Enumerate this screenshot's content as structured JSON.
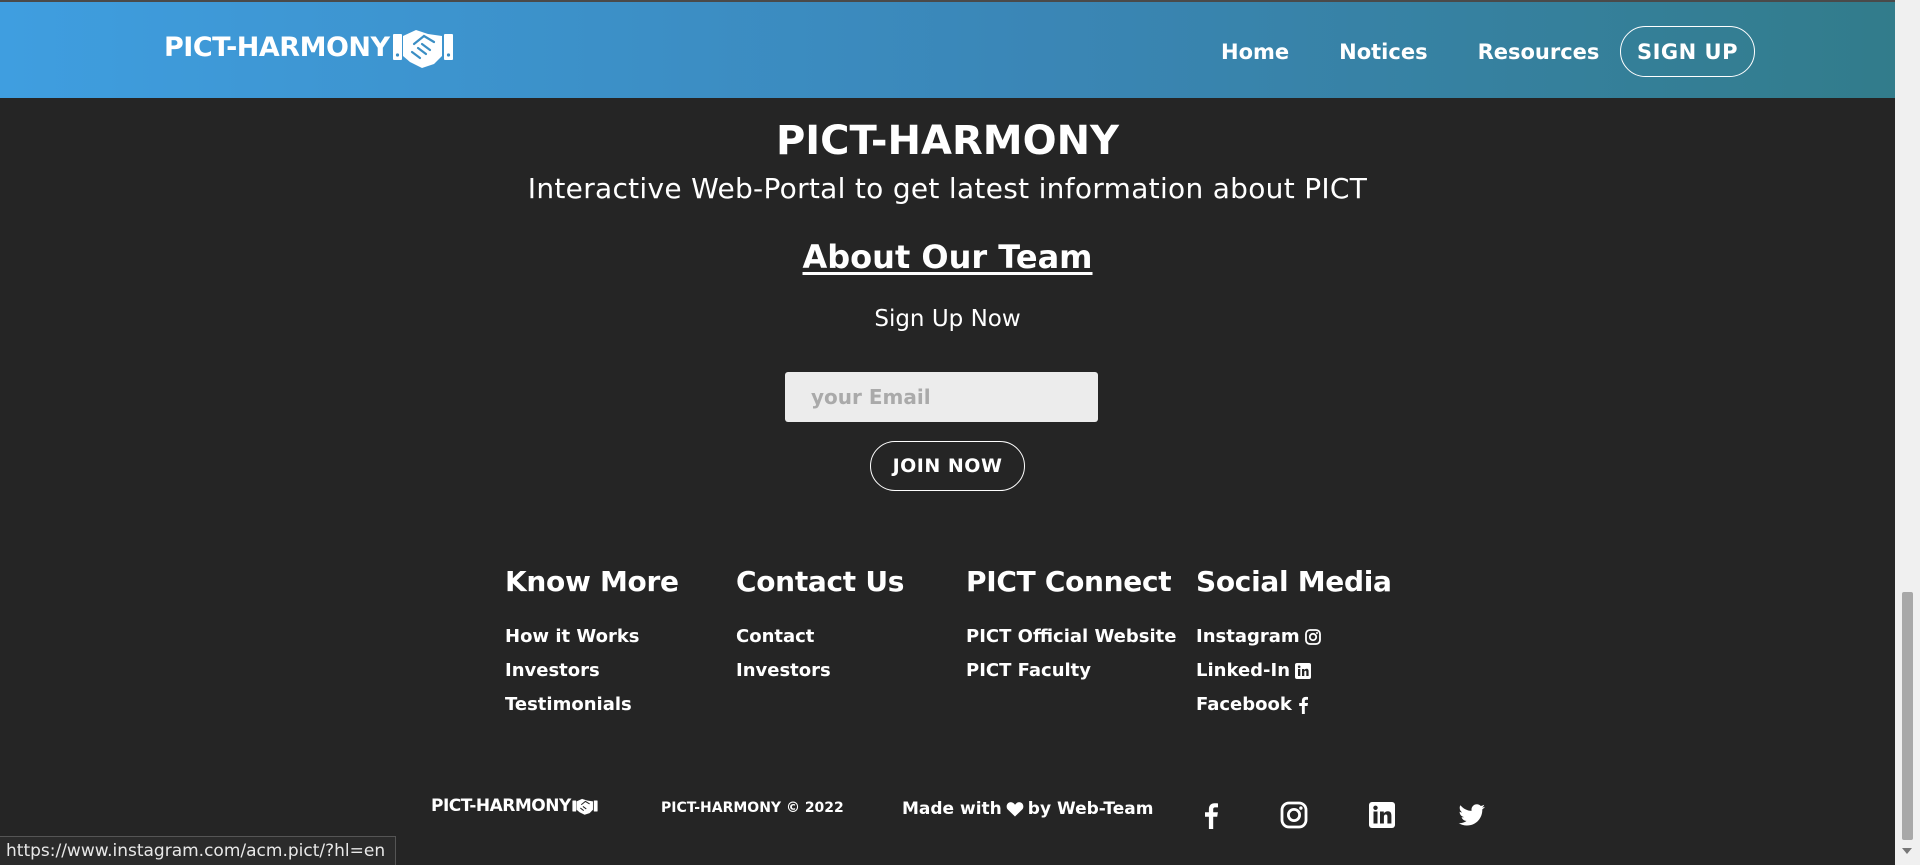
{
  "header": {
    "brand": "PICT-HARMONY",
    "nav": [
      "Home",
      "Notices",
      "Resources"
    ],
    "signup_label": "SIGN UP"
  },
  "hero": {
    "title": "PICT-HARMONY",
    "tagline": "Interactive Web-Portal to get latest information about PICT",
    "about_link": "About Our Team",
    "signup_prompt": "Sign Up Now",
    "email_placeholder": "your Email",
    "join_label": "JOIN NOW"
  },
  "footer": {
    "columns": [
      {
        "title": "Know More",
        "links": [
          "How it Works",
          "Investors",
          "Testimonials"
        ]
      },
      {
        "title": "Contact Us",
        "links": [
          "Contact",
          "Investors"
        ]
      },
      {
        "title": "PICT Connect",
        "links": [
          "PICT Official Website",
          "PICT Faculty"
        ]
      },
      {
        "title": "Social Media",
        "links": [
          "Instagram",
          "Linked-In",
          "Facebook"
        ]
      }
    ],
    "bottom": {
      "brand": "PICT-HARMONY",
      "copyright": "PICT-HARMONY © 2022",
      "made_with_prefix": "Made with",
      "made_with_suffix": "by Web-Team"
    },
    "social_icons": [
      "facebook-icon",
      "instagram-icon",
      "linkedin-icon",
      "twitter-icon"
    ]
  },
  "status_bar": {
    "url": "https://www.instagram.com/acm.pict/?hl=en"
  },
  "colors": {
    "header_gradient_start": "#3f9ee0",
    "header_gradient_end": "#327c8b",
    "page_background": "#252525"
  }
}
